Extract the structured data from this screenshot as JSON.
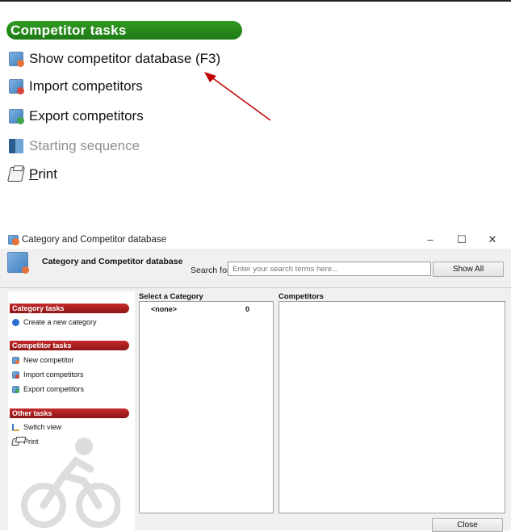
{
  "top_panel": {
    "heading": "Competitor  tasks",
    "items": [
      {
        "label": "Show competitor database (F3)",
        "icon": "competitor-database-icon",
        "enabled": true
      },
      {
        "label": "Import competitors",
        "icon": "import-competitors-icon",
        "enabled": true
      },
      {
        "label": "Export competitors",
        "icon": "export-competitors-icon",
        "enabled": true
      },
      {
        "label": "Starting sequence",
        "icon": "starting-sequence-icon",
        "enabled": false
      },
      {
        "label_underlined": "P",
        "label_rest": "rint",
        "icon": "print-icon",
        "enabled": true
      }
    ]
  },
  "annotation": {
    "color": "#c00000"
  },
  "window": {
    "title": "Category and Competitor database",
    "controls": {
      "minimize": "–",
      "maximize": "☐",
      "close": "✕"
    },
    "header_title": "Category and Competitor database",
    "search": {
      "label": "Search for:",
      "placeholder": "Enter your search terms here..."
    },
    "show_all": "Show All",
    "close_button": "Close"
  },
  "task_pane": {
    "sections": [
      {
        "title": "Category tasks",
        "items": [
          {
            "label": "Create a new category",
            "icon": "create-category-icon"
          }
        ]
      },
      {
        "title": "Competitor  tasks",
        "items": [
          {
            "label": "New competitor",
            "icon": "new-competitor-icon"
          },
          {
            "label": "Import competitors",
            "icon": "import-competitors-icon"
          },
          {
            "label": "Export competitors",
            "icon": "export-competitors-icon"
          }
        ]
      },
      {
        "title": "Other tasks",
        "items": [
          {
            "label": "Switch view",
            "icon": "switch-view-icon"
          },
          {
            "label": "Print",
            "icon": "print-icon"
          }
        ]
      }
    ],
    "header_color": "#b01e1e"
  },
  "category_pane": {
    "title": "Select a Category",
    "rows": [
      {
        "name": "<none>",
        "count": "0"
      }
    ]
  },
  "competitor_pane": {
    "title": "Competitors"
  },
  "colors": {
    "accent_green": "#1f7a16",
    "section_red": "#b01e1e"
  }
}
